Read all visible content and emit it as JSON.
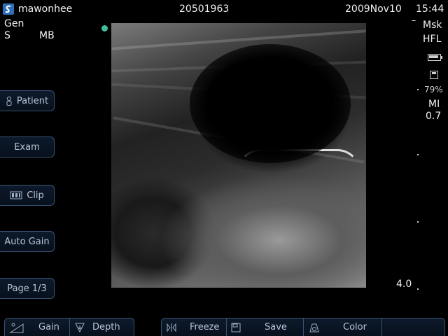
{
  "header": {
    "logo_icon": "s-logo-icon",
    "user": "mawonhee",
    "id": "20501963",
    "date": "2009Nov10",
    "time": "15:44"
  },
  "left_info": {
    "line1": "Gen",
    "line2_a": "S",
    "line2_b": "MB"
  },
  "right_info": {
    "preset": "Msk",
    "probe": "HFL",
    "battery_icon": "battery-icon",
    "storage_icon": "save-disk-icon",
    "storage_percent": "79%",
    "mi_label": "MI",
    "mi_value": "0.7",
    "depth_value": "4.0"
  },
  "side_buttons": [
    {
      "label": "Patient",
      "icon": "person-icon"
    },
    {
      "label": "Exam",
      "icon": ""
    },
    {
      "label": "Clip",
      "icon": "film-icon"
    },
    {
      "label": "Auto Gain",
      "icon": ""
    },
    {
      "label": "Page 1/3",
      "icon": ""
    }
  ],
  "bottom_left": [
    {
      "label": "Gain",
      "icon": "gain-icon"
    },
    {
      "label": "Depth",
      "icon": "depth-icon"
    }
  ],
  "bottom_right": [
    {
      "label": "Freeze",
      "icon": "freeze-icon"
    },
    {
      "label": "Save",
      "icon": "save-icon"
    },
    {
      "label": "Color",
      "icon": "color-icon"
    }
  ],
  "colors": {
    "accent_dot": "#3fbfa0",
    "button_border": "#3a5170",
    "button_text": "#b9c6d8"
  }
}
